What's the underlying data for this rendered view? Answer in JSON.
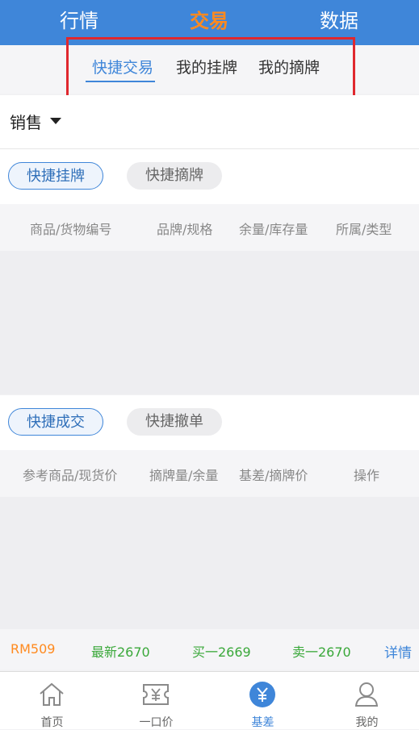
{
  "top_tabs": [
    {
      "label": "行情",
      "active": false
    },
    {
      "label": "交易",
      "active": true
    },
    {
      "label": "数据",
      "active": false
    }
  ],
  "sub_tabs": [
    {
      "label": "快捷交易",
      "active": true
    },
    {
      "label": "我的挂牌",
      "active": false
    },
    {
      "label": "我的摘牌",
      "active": false
    }
  ],
  "sales_selector": {
    "label": "销售"
  },
  "listing_section": {
    "pills": [
      {
        "label": "快捷挂牌",
        "active": true
      },
      {
        "label": "快捷摘牌",
        "active": false
      }
    ],
    "columns": [
      "商品/货物编号",
      "品牌/规格",
      "余量/库存量",
      "所属/类型"
    ]
  },
  "deal_section": {
    "pills": [
      {
        "label": "快捷成交",
        "active": true
      },
      {
        "label": "快捷撤单",
        "active": false
      }
    ],
    "columns": [
      "参考商品/现货价",
      "摘牌量/余量",
      "基差/摘牌价",
      "操作"
    ]
  },
  "ticker": {
    "symbol": "RM509",
    "latest": "最新2670",
    "buy1": "买一2669",
    "sell1": "卖一2670",
    "detail": "详情"
  },
  "bottom_nav": [
    {
      "label": "首页",
      "icon": "home-icon",
      "active": false
    },
    {
      "label": "一口价",
      "icon": "ticket-yen-icon",
      "active": false
    },
    {
      "label": "基差",
      "icon": "yen-circle-icon",
      "active": true
    },
    {
      "label": "我的",
      "icon": "user-icon",
      "active": false
    }
  ],
  "colors": {
    "primary": "#3f86d9",
    "accent_orange": "#ff8a1f",
    "highlight_red": "#e0282e",
    "price_green": "#3aa83a"
  }
}
